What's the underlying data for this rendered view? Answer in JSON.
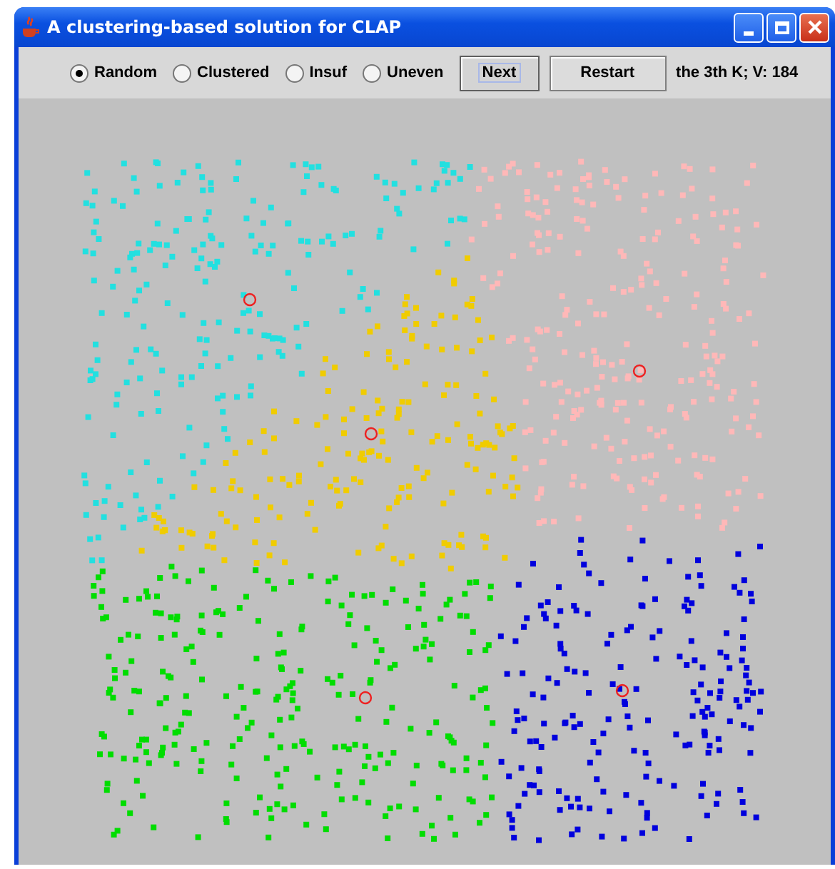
{
  "window": {
    "title": "A clustering-based solution for CLAP"
  },
  "modes": [
    {
      "label": "Random",
      "selected": true
    },
    {
      "label": "Clustered",
      "selected": false
    },
    {
      "label": "Insuf",
      "selected": false
    },
    {
      "label": "Uneven",
      "selected": false
    }
  ],
  "buttons": [
    {
      "label": "Next",
      "focused": true
    },
    {
      "label": "Restart",
      "focused": false
    }
  ],
  "status": "the 3th K; V: 184",
  "clusters": [
    {
      "color": "#22e0e0"
    },
    {
      "color": "#ffb8b8"
    },
    {
      "color": "#f0cc00"
    },
    {
      "color": "#00dd00"
    },
    {
      "color": "#0000dd"
    }
  ]
}
